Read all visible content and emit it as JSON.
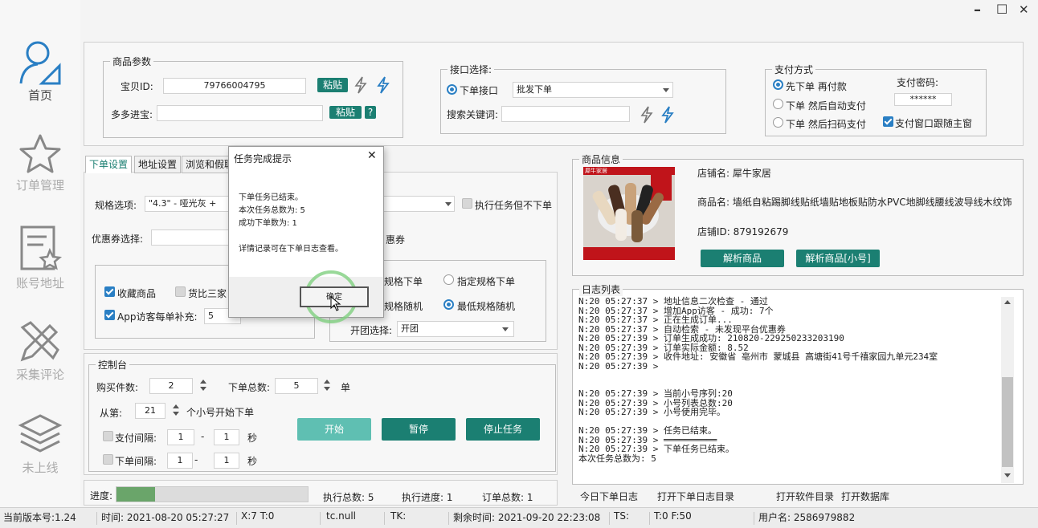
{
  "window": {
    "minimize": "–",
    "maximize": "☐",
    "close": "✕"
  },
  "sidebar": [
    {
      "label": "首页",
      "icon": "user-icon",
      "active": true
    },
    {
      "label": "订单管理",
      "icon": "star-icon"
    },
    {
      "label": "账号地址",
      "icon": "document-star-icon"
    },
    {
      "label": "采集评论",
      "icon": "pencil-ruler-icon"
    },
    {
      "label": "未上线",
      "icon": "layers-icon"
    }
  ],
  "product_params": {
    "title": "商品参数",
    "item_id_label": "宝贝ID:",
    "item_id_value": "79766004795",
    "paste": "粘贴",
    "duo_label": "多多进宝:",
    "duo_value": "",
    "help": "?"
  },
  "interface": {
    "title": "接口选择:",
    "order_api_label": "下单接口",
    "order_api_value": "批发下单",
    "keyword_label": "搜索关键词:",
    "keyword_value": ""
  },
  "payment": {
    "title": "支付方式",
    "opt1": "先下单 再付款",
    "opt2": "下单 然后自动支付",
    "opt3": "下单 然后扫码支付",
    "pwd_label": "支付密码:",
    "pwd_value": "******",
    "follow_label": "支付窗口跟随主窗"
  },
  "tabs": [
    "下单设置",
    "地址设置",
    "浏览和假聊"
  ],
  "order_settings": {
    "spec_label": "规格选项:",
    "spec_value": "\"4.3\" - 哑光灰 +",
    "coupon_label": "优惠券选择:",
    "exec_no_order": "执行任务但不下单",
    "coupon_tail": "惠券",
    "collect": "收藏商品",
    "compare": "货比三家",
    "app_visit": "App访客每单补充:",
    "app_visit_value": "5",
    "spec_order": "规格下单",
    "specified_spec": "指定规格下单",
    "spec_random": "规格随机",
    "lowest_random": "最低规格随机",
    "group_label": "开团选择:",
    "group_value": "开团"
  },
  "dialog": {
    "title": "任务完成提示",
    "line1": "下单任务已结束。",
    "line2": "本次任务总数为: 5",
    "line3": "成功下单数为: 1",
    "line4": "详情记录可在下单日志查看。",
    "ok": "确定"
  },
  "control": {
    "title": "控制台",
    "qty_label": "购买件数:",
    "qty_value": "2",
    "total_label": "下单总数:",
    "total_value": "5",
    "unit": "单",
    "from_label": "从第:",
    "from_value": "21",
    "from_suffix": "个小号开始下单",
    "pay_interval": "支付间隔:",
    "order_interval": "下单间隔:",
    "v1": "1",
    "v2": "1",
    "dash": "-",
    "sec": "秒",
    "start": "开始",
    "pause": "暂停",
    "stop": "停止任务"
  },
  "progress": {
    "label": "进度:",
    "fraction": 0.2,
    "exec_total": "执行总数: 5",
    "exec_progress": "执行进度: 1",
    "order_total": "订单总数: 1"
  },
  "product_info": {
    "title": "商品信息",
    "shop_label": "店铺名: 犀牛家居",
    "product_label": "商品名: 墙纸自粘踢脚线贴纸墙贴地板贴防水PVC地脚线腰线波导线木纹饰",
    "shop_id": "店铺ID: 879192679",
    "parse": "解析商品",
    "parse_small": "解析商品[小号]",
    "thumb_tag": "犀牛家居"
  },
  "log": {
    "title": "日志列表",
    "lines": [
      "N:20 05:27:37 > 地址信息二次检查 - 通过",
      "N:20 05:27:37 > 增加App访客 - 成功: 7个",
      "N:20 05:27:37 > 正在生成订单...",
      "N:20 05:27:37 > 自动检索 - 未发现平台优惠券",
      "N:20 05:27:39 > 订单生成成功: 210820-229250233203190",
      "N:20 05:27:39 > 订单实际金额: 8.52",
      "N:20 05:27:39 > 收件地址: 安徽省 亳州市 蒙城县 高塘街41号千禧家园九单元234室",
      "N:20 05:27:39 >",
      "",
      "",
      "N:20 05:27:39 > 当前小号序列:20",
      "N:20 05:27:39 > 小号列表总数:20",
      "N:20 05:27:39 > 小号使用完毕。",
      "",
      "N:20 05:27:39 > 任务已结束。",
      "N:20 05:27:39 > ══════════",
      "N:20 05:27:39 > 下单任务已结束。",
      "本次任务总数为: 5"
    ],
    "btn_today": "今日下单日志",
    "btn_open_log": "打开下单日志目录",
    "btn_open_soft": "打开软件目录",
    "btn_open_db": "打开数据库"
  },
  "statusbar": {
    "version": "当前版本号:1.24",
    "time": "时间: 2021-08-20 05:27:27",
    "xt": "X:7 T:0",
    "tc": "tc.null",
    "tk": "TK:",
    "remain": "剩余时间: 2021-09-20 22:23:08",
    "ts": "TS:",
    "tf": "T:0 F:50",
    "user": "用户名: 2586979882"
  },
  "colors": {
    "accent": "#1b7f72",
    "accent_light": "#5fbfb2",
    "check": "#2a7fc4",
    "progress": "#6aa56a",
    "highlight_ring": "#7fd07f"
  }
}
